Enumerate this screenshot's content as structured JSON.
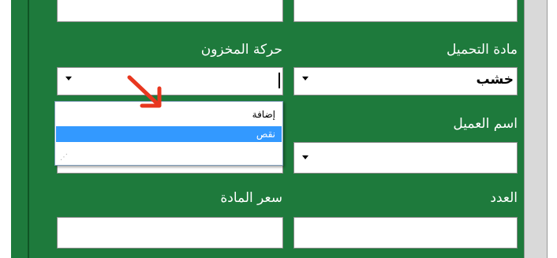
{
  "form": {
    "labels": {
      "stock_movement": "حركة المخزون",
      "loading_material": "مادة التحميل",
      "customer_name": "اسم العميل",
      "material_price": "سعر المادة",
      "count": "العدد"
    },
    "loading_material_value": "خشب",
    "stock_movement_value": "",
    "customer_name_value": ""
  },
  "dropdown": {
    "options": [
      "إضافة",
      "نقص",
      ""
    ],
    "selected_index": 1
  },
  "colors": {
    "panel_bg": "#1e7a3c",
    "highlight": "#3399ff",
    "annotation_arrow": "#e8371f"
  },
  "icons": {
    "dropdown_arrow": "triangle-down",
    "annotation": "red-arrow-pointing"
  }
}
